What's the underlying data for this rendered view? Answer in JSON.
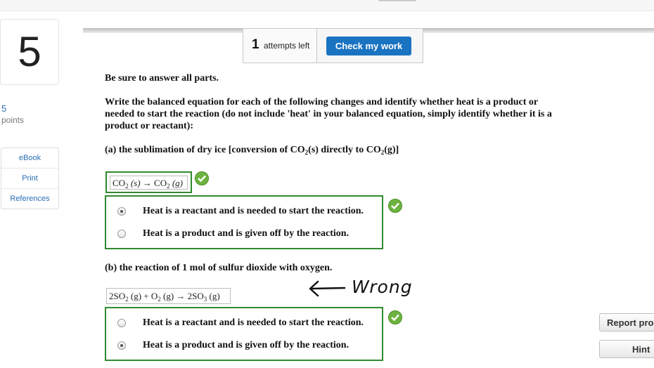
{
  "question": {
    "number": "5",
    "points_value": "5",
    "points_label": "points"
  },
  "tools": [
    "eBook",
    "Print",
    "References"
  ],
  "attempts": {
    "count": "1",
    "label": "attempts left",
    "check_button": "Check my work"
  },
  "instructions": {
    "line1": "Be sure to answer all parts.",
    "line2": "Write the balanced equation for each of the following changes and identify whether heat is a product or needed to start the reaction (do not include 'heat' in your balanced equation, simply identify whether it is a product or reactant):"
  },
  "part_a": {
    "prompt_pre": "(a) the sublimation of dry ice [conversion of CO",
    "prompt_sub1": "2",
    "prompt_mid": "(s) directly to CO",
    "prompt_sub2": "2",
    "prompt_post": "(g)]",
    "equation": {
      "left": "CO",
      "left_sub": "2",
      "left_state": " (s) ",
      "arrow": "→",
      "right": " CO",
      "right_sub": "2",
      "right_state": " (g)"
    },
    "options": [
      {
        "label": "Heat is a reactant and is needed to start the reaction.",
        "selected": true
      },
      {
        "label": "Heat is a product and is given off by the reaction.",
        "selected": false
      }
    ]
  },
  "part_b": {
    "prompt": "(b) the reaction of 1 mol of sulfur dioxide with oxygen.",
    "equation": {
      "t1": "2SO",
      "s1": "2",
      "t2": " (g) + O",
      "s2": "2",
      "t3": " (g) → 2SO",
      "s3": "3",
      "t4": " (g)"
    },
    "annotation": "Wrong",
    "options": [
      {
        "label": "Heat is a reactant and is needed to start the reaction.",
        "selected": false
      },
      {
        "label": "Heat is a product and is given off by the reaction.",
        "selected": true
      }
    ]
  },
  "side_buttons": {
    "report": "Report pro",
    "hint": "Hint"
  },
  "colors": {
    "accent": "#1a73c1",
    "correct": "#6db33f",
    "correct_border": "#2e8b2e",
    "link": "#2a6db5"
  }
}
